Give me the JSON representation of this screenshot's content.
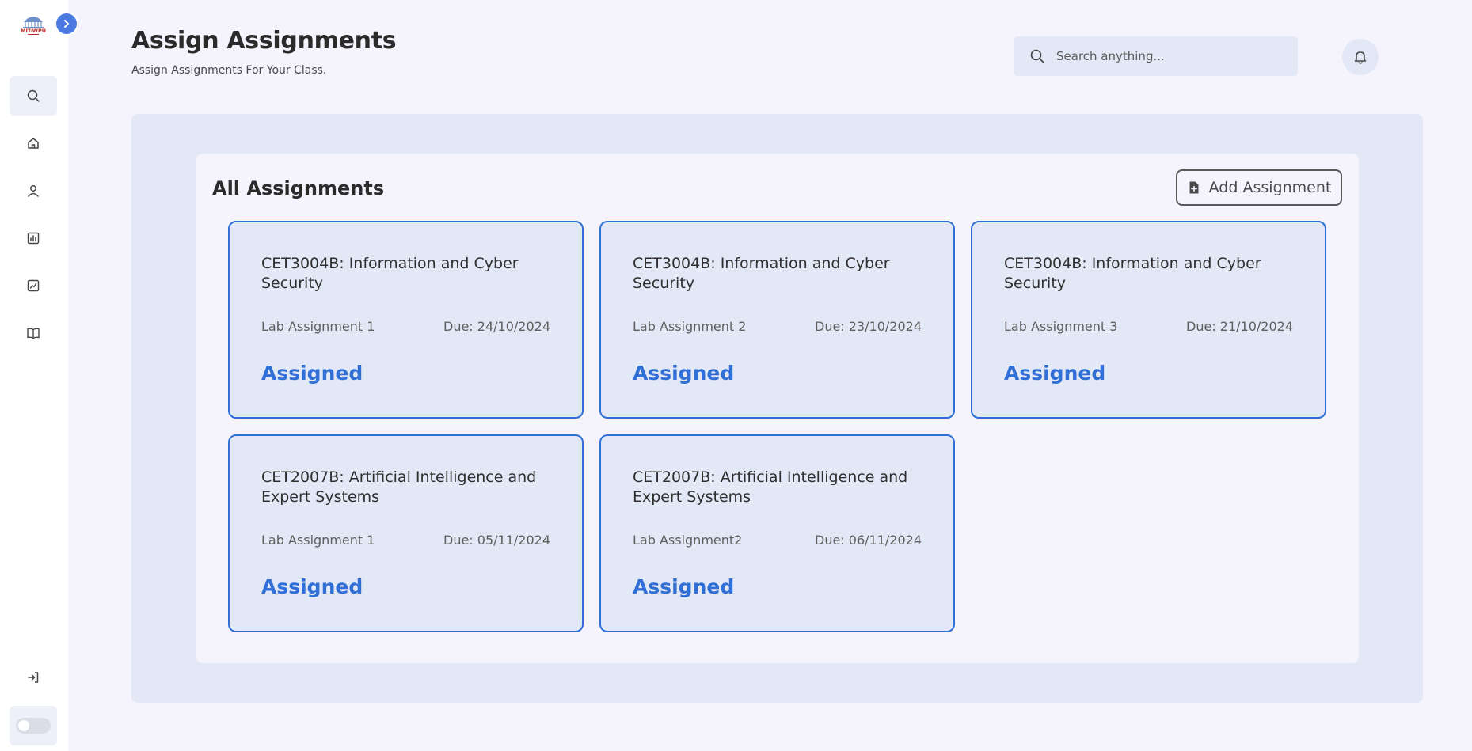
{
  "sidebar": {
    "logo_text": "MIT-WPU",
    "nav": [
      {
        "name": "search",
        "icon": "search-icon"
      },
      {
        "name": "home",
        "icon": "home-icon"
      },
      {
        "name": "profile",
        "icon": "user-icon"
      },
      {
        "name": "reports",
        "icon": "bar-chart-icon"
      },
      {
        "name": "analytics",
        "icon": "line-chart-icon"
      },
      {
        "name": "courses",
        "icon": "book-icon"
      },
      {
        "name": "logout",
        "icon": "logout-icon"
      }
    ],
    "theme_toggle": "off"
  },
  "header": {
    "title": "Assign Assignments",
    "subtitle": "Assign Assignments For Your Class.",
    "search_placeholder": "Search anything..."
  },
  "main": {
    "section_title": "All Assignments",
    "add_button_label": "Add Assignment",
    "accent_color": "#2f6fd6",
    "assignments": [
      {
        "course": "CET3004B: Information and Cyber Security",
        "name": "Lab Assignment 1",
        "due": "Due: 24/10/2024",
        "status": "Assigned"
      },
      {
        "course": "CET3004B: Information and Cyber Security",
        "name": "Lab Assignment 2",
        "due": "Due: 23/10/2024",
        "status": "Assigned"
      },
      {
        "course": "CET3004B: Information and Cyber Security",
        "name": "Lab Assignment 3",
        "due": "Due: 21/10/2024",
        "status": "Assigned"
      },
      {
        "course": "CET2007B: Artificial Intelligence and Expert Systems",
        "name": "Lab Assignment 1",
        "due": "Due: 05/11/2024",
        "status": "Assigned"
      },
      {
        "course": "CET2007B: Artificial Intelligence and Expert Systems",
        "name": "Lab Assignment2",
        "due": "Due: 06/11/2024",
        "status": "Assigned"
      }
    ]
  }
}
